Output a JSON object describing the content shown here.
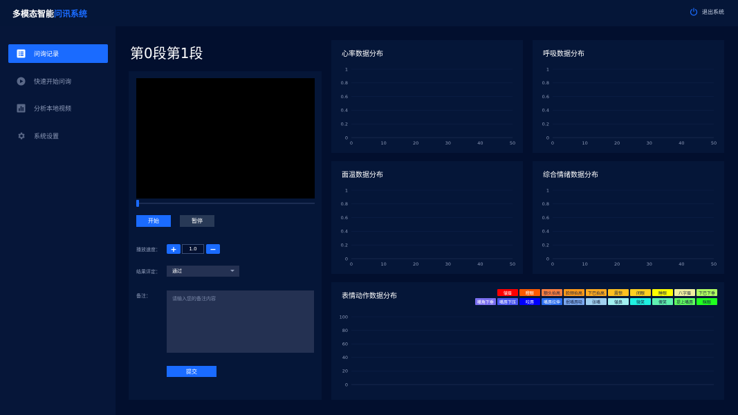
{
  "app": {
    "title_main": "多模态智能",
    "title_accent": "问讯系统",
    "logout_label": "退出系统"
  },
  "sidebar": {
    "items": [
      {
        "label": "问询记录",
        "icon": "list-icon",
        "active": true
      },
      {
        "label": "快速开始问询",
        "icon": "play-circle-icon",
        "active": false
      },
      {
        "label": "分析本地视频",
        "icon": "bar-chart-icon",
        "active": false
      },
      {
        "label": "系统设置",
        "icon": "gear-icon",
        "active": false
      }
    ]
  },
  "page": {
    "title": "第0段第1段"
  },
  "player": {
    "progress": 0,
    "start_label": "开始",
    "pause_label": "暂停",
    "speed_label": "播放速度：",
    "speed_plus": "+",
    "speed_minus": "−",
    "speed_value": "1.0",
    "result_label": "结果评定：",
    "result_value": "通过",
    "notes_label": "备注：",
    "notes_placeholder": "请输入您的备注内容",
    "notes_value": "",
    "submit_label": "提交"
  },
  "colors": {
    "accent": "#1a6bff",
    "background": "#020f2e",
    "panel": "#051638",
    "input_bg": "#243152"
  },
  "chart_data": [
    {
      "id": "heart-rate",
      "type": "line",
      "title": "心率数据分布",
      "xlim": [
        0,
        50
      ],
      "ylim": [
        0,
        1
      ],
      "x_ticks": [
        "0",
        "10",
        "20",
        "30",
        "40",
        "50"
      ],
      "y_ticks": [
        "0",
        "0.2",
        "0.4",
        "0.6",
        "0.8",
        "1"
      ],
      "series": []
    },
    {
      "id": "respiration",
      "type": "line",
      "title": "呼吸数据分布",
      "xlim": [
        0,
        50
      ],
      "ylim": [
        0,
        1
      ],
      "x_ticks": [
        "0",
        "10",
        "20",
        "30",
        "40",
        "50"
      ],
      "y_ticks": [
        "0",
        "0.2",
        "0.4",
        "0.6",
        "0.8",
        "1"
      ],
      "series": []
    },
    {
      "id": "face-temperature",
      "type": "line",
      "title": "面温数据分布",
      "xlim": [
        0,
        50
      ],
      "ylim": [
        0,
        1
      ],
      "x_ticks": [
        "0",
        "10",
        "20",
        "30",
        "40",
        "50"
      ],
      "y_ticks": [
        "0",
        "0.2",
        "0.4",
        "0.6",
        "0.8",
        "1"
      ],
      "series": []
    },
    {
      "id": "emotion-composite",
      "type": "line",
      "title": "综合情绪数据分布",
      "xlim": [
        0,
        50
      ],
      "ylim": [
        0,
        1
      ],
      "x_ticks": [
        "0",
        "10",
        "20",
        "30",
        "40",
        "50"
      ],
      "y_ticks": [
        "0",
        "0.2",
        "0.4",
        "0.6",
        "0.8",
        "1"
      ],
      "series": []
    },
    {
      "id": "expression-action",
      "type": "bar",
      "title": "表情动作数据分布",
      "ylim": [
        0,
        100
      ],
      "y_ticks": [
        "0",
        "20",
        "40",
        "60",
        "80",
        "100"
      ],
      "legend_rows": [
        [
          {
            "label": "皱眉",
            "color": "#ff0000"
          },
          {
            "label": "瞪眼",
            "color": "#ff5a00"
          },
          {
            "label": "额头抬高",
            "color": "#ff8040"
          },
          {
            "label": "脸颊抬高",
            "color": "#ff9a1a"
          },
          {
            "label": "下巴抬高",
            "color": "#ffab20"
          },
          {
            "label": "震惊",
            "color": "#ffc020"
          },
          {
            "label": "闭眼",
            "color": "#ffd020"
          },
          {
            "label": "睡眼",
            "color": "#ffff00"
          },
          {
            "label": "八字眉",
            "color": "#f0f0a0"
          },
          {
            "label": "下巴下垂",
            "color": "#b0ff60"
          }
        ],
        [
          {
            "label": "嘴角下垂",
            "color": "#7a6ef0"
          },
          {
            "label": "嘴唇下压",
            "color": "#4a56f0"
          },
          {
            "label": "咬唇",
            "color": "#0000ff"
          },
          {
            "label": "嘴唇拉伸",
            "color": "#2a6ef0"
          },
          {
            "label": "抿嘴唇吸",
            "color": "#7aa8f0"
          },
          {
            "label": "张嘴",
            "color": "#a0d0f0"
          },
          {
            "label": "皱鼻",
            "color": "#a0f0f0"
          },
          {
            "label": "微笑",
            "color": "#20f0e0"
          },
          {
            "label": "傻笑",
            "color": "#60f0b0"
          },
          {
            "label": "提上嘴唇",
            "color": "#60ff60"
          },
          {
            "label": "眯眼",
            "color": "#20ff20"
          }
        ]
      ],
      "series": []
    }
  ]
}
